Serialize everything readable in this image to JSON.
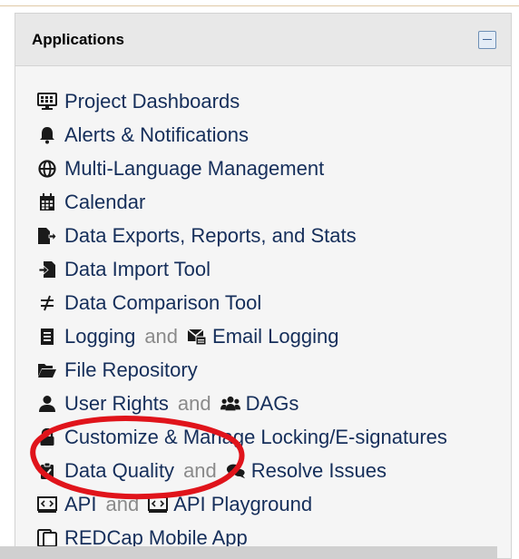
{
  "panel": {
    "title": "Applications"
  },
  "items": [
    {
      "icon": "monitor-icon",
      "label": "Project Dashboards"
    },
    {
      "icon": "bell-icon",
      "label": "Alerts & Notifications"
    },
    {
      "icon": "globe-icon",
      "label": "Multi-Language Management"
    },
    {
      "icon": "calendar-icon",
      "label": "Calendar"
    },
    {
      "icon": "file-export-icon",
      "label": "Data Exports, Reports, and Stats"
    },
    {
      "icon": "file-import-icon",
      "label": "Data Import Tool"
    },
    {
      "icon": "not-equal-icon",
      "label": "Data Comparison Tool"
    },
    {
      "icon": "list-icon",
      "label": "Logging",
      "joiner": "and",
      "icon2": "mail-log-icon",
      "label2": "Email Logging"
    },
    {
      "icon": "folder-open-icon",
      "label": "File Repository"
    },
    {
      "icon": "user-icon",
      "label": "User Rights",
      "joiner": "and",
      "icon2": "users-icon",
      "label2": "DAGs"
    },
    {
      "icon": "lock-icon",
      "label": "Customize & Manage Locking/E-signatures"
    },
    {
      "icon": "clipboard-check-icon",
      "label": "Data Quality",
      "joiner": "and",
      "icon2": "comments-icon",
      "label2": "Resolve Issues"
    },
    {
      "icon": "code-icon",
      "label": "API",
      "joiner": "and",
      "icon2": "code-icon",
      "label2": "API Playground"
    },
    {
      "icon": "mobile-icon",
      "label": "REDCap Mobile App"
    }
  ],
  "colors": {
    "link": "#152e5a",
    "muted": "#8a8a8a",
    "annotation": "#e0141b"
  }
}
